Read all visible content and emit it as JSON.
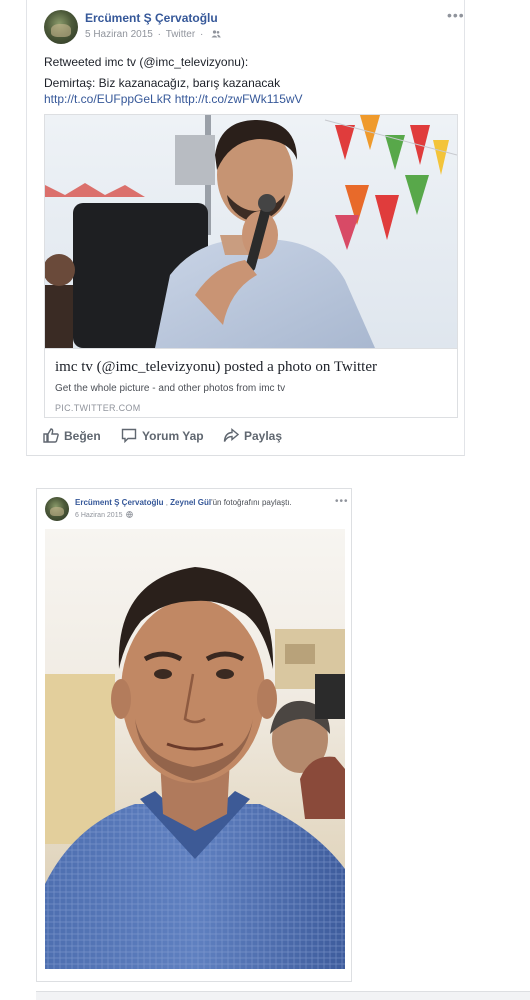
{
  "post1": {
    "author": "Ercüment Ş Çervatoğlu",
    "date": "5 Haziran 2015",
    "source": "Twitter",
    "privacy_icon": "friends-icon",
    "text_line1": "Retweeted imc tv (@imc_televizyonu):",
    "text_line2": "Demirtaş: Biz kazanacağız, barış kazanacak",
    "link1": "http://t.co/EUFppGeLkR",
    "link2": "http://t.co/zwFWk115wV",
    "card": {
      "title": "imc tv (@imc_televizyonu) posted a photo on Twitter",
      "description": "Get the whole picture - and other photos from imc tv",
      "domain": "PIC.TWITTER.COM"
    },
    "actions": {
      "like": "Beğen",
      "comment": "Yorum Yap",
      "share": "Paylaş"
    }
  },
  "post2": {
    "author": "Ercüment Ş Çervatoğlu",
    "shared_from": "Zeynel Gül",
    "shared_text": "'ün fotoğrafını paylaştı.",
    "date": "6 Haziran 2015",
    "privacy_icon": "globe-icon"
  },
  "colors": {
    "link": "#365899",
    "meta": "#90949c",
    "text": "#1d2129",
    "border": "#dddfe2"
  }
}
